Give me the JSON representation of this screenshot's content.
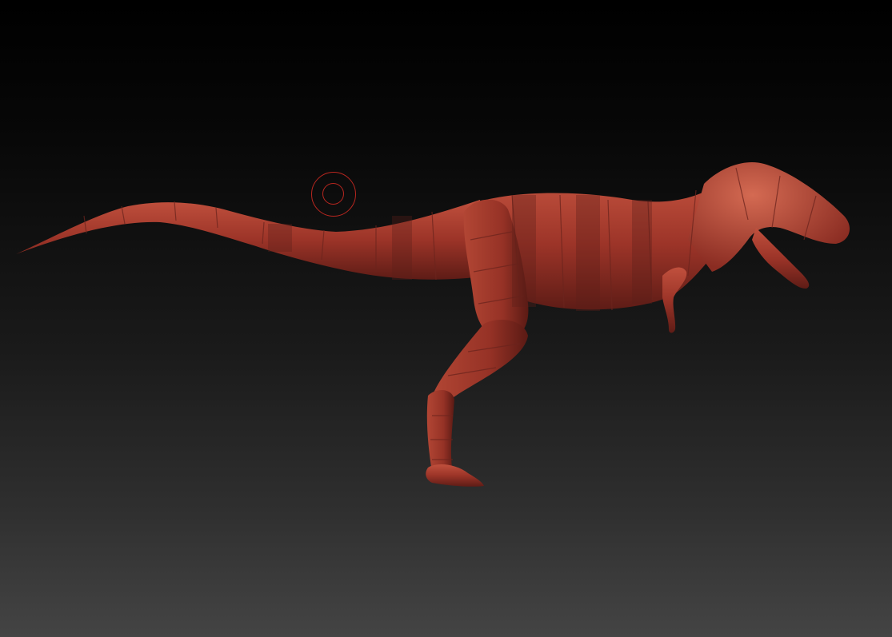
{
  "viewport": {
    "background_top": "#000000",
    "background_bottom": "#444444"
  },
  "model": {
    "subject": "dinosaur-base-mesh",
    "material_color": "#a8382a",
    "band_color": "#6e2a24",
    "highlight_color": "#c85a45"
  },
  "brush_cursor": {
    "color": "#b8261f"
  }
}
